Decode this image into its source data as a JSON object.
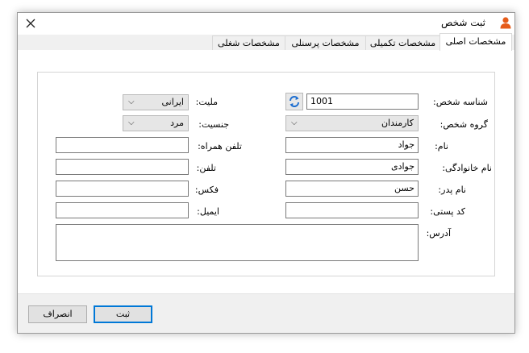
{
  "window": {
    "title": "ثبت شخص",
    "close_icon": "close-icon",
    "app_icon": "person-icon",
    "app_icon_color": "#e65c1a"
  },
  "tabs": [
    {
      "label": "مشخصات اصلی",
      "active": true
    },
    {
      "label": "مشخصات تکمیلی",
      "active": false
    },
    {
      "label": "مشخصات پرسنلی",
      "active": false
    },
    {
      "label": "مشخصات شغلی",
      "active": false
    }
  ],
  "form": {
    "person_id": {
      "label": "شناسه شخص:",
      "value": "1001",
      "refresh_icon": "refresh-icon"
    },
    "nationality": {
      "label": "ملیت:",
      "value": "ایرانی"
    },
    "person_group": {
      "label": "گروه شخص:",
      "value": "کارمندان"
    },
    "gender": {
      "label": "جنسیت:",
      "value": "مرد"
    },
    "first_name": {
      "label": "نام:",
      "value": "جواد"
    },
    "mobile": {
      "label": "تلفن همراه:",
      "value": ""
    },
    "last_name": {
      "label": "نام خانوادگی:",
      "value": "جوادی"
    },
    "phone": {
      "label": "تلفن:",
      "value": ""
    },
    "father_name": {
      "label": "نام پدر:",
      "value": "حسن"
    },
    "fax": {
      "label": "فکس:",
      "value": ""
    },
    "postal_code": {
      "label": "کد پستی:",
      "value": ""
    },
    "email": {
      "label": "ایمیل:",
      "value": ""
    },
    "address": {
      "label": "آدرس:",
      "value": ""
    }
  },
  "buttons": {
    "submit": "ثبت",
    "cancel": "انصراف"
  },
  "colors": {
    "accent": "#0078d7",
    "refresh_icon": "#1e6fd0"
  }
}
